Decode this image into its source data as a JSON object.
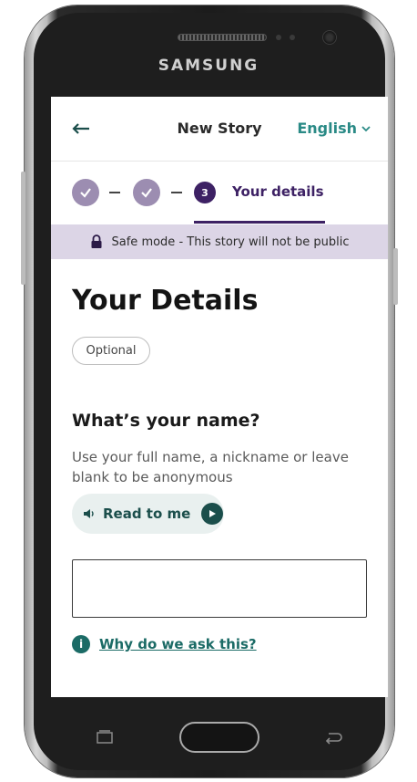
{
  "device": {
    "brand": "SAMSUNG"
  },
  "topbar": {
    "back_icon": "arrow-left-icon",
    "title": "New Story",
    "language": "English"
  },
  "steps": {
    "completed_icon": "check-icon",
    "current_number": "3",
    "current_label": "Your details"
  },
  "safe_banner": {
    "icon": "lock-icon",
    "text": "Safe mode - This story will not be public"
  },
  "main": {
    "title": "Your Details",
    "optional_badge": "Optional",
    "question": "What’s your name?",
    "help_text": "Use your full name, a nickname or leave blank to be anonymous",
    "read_to_me": "Read to me",
    "name_input": {
      "value": "",
      "placeholder": ""
    },
    "why_link": "Why do we ask this?"
  },
  "colors": {
    "brand_purple": "#3d2164",
    "completed_step": "#9c8db1",
    "banner_bg": "#dcd5e6",
    "teal": "#2a8a86",
    "dark_teal": "#1b6b66"
  }
}
